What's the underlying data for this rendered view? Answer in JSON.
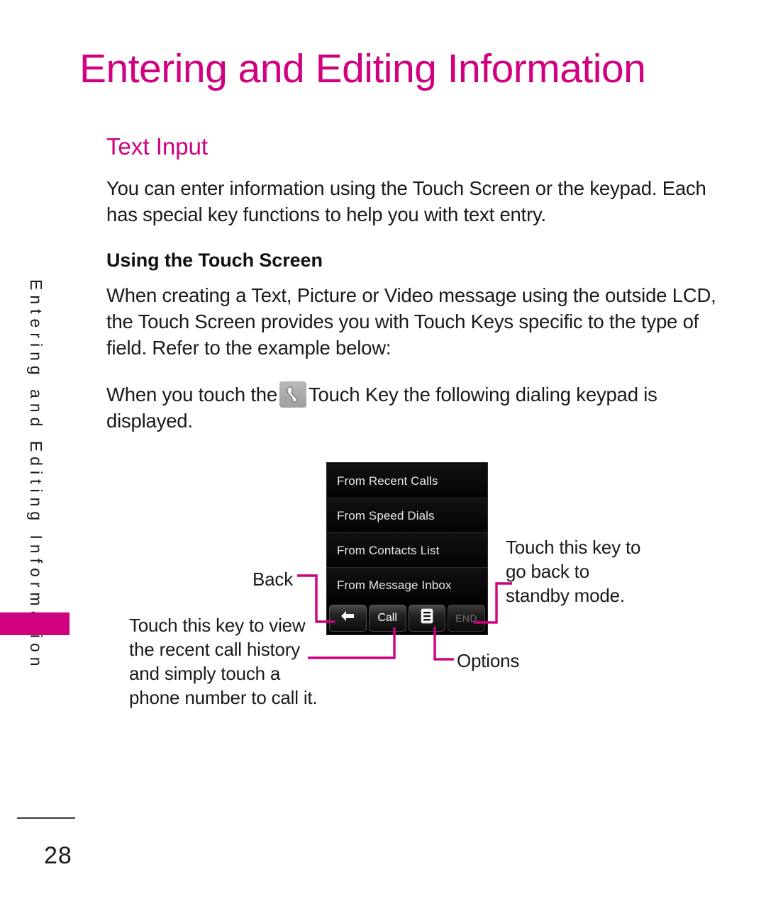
{
  "page": {
    "header_title": "Entering and Editing Information",
    "side_tab_text": "Entering and Editing Information",
    "page_number": "28",
    "accent_color": "#D1007E"
  },
  "section": {
    "title": "Text Input",
    "intro_paragraph": "You can enter information using the Touch Screen or the keypad. Each has special key functions to help you with text entry.",
    "subheading": "Using the Touch Screen",
    "touch_paragraph": "When creating a Text, Picture or Video message using the outside LCD, the Touch Screen provides you with Touch Keys specific to the type of field. Refer to the example below:",
    "when_paragraph_before": "When you touch the",
    "when_paragraph_after": "Touch Key the following dialing keypad is displayed.",
    "inline_icon_name": "phone-handset-icon"
  },
  "lcd": {
    "menu_items": [
      "From Recent Calls",
      "From Speed Dials",
      "From Contacts List",
      "From Message Inbox"
    ],
    "buttons": [
      {
        "label": "",
        "icon": "back-arrow-icon",
        "name": "back-key",
        "dim": false
      },
      {
        "label": "Call",
        "icon": "",
        "name": "call-key",
        "dim": false
      },
      {
        "label": "",
        "icon": "options-list-icon",
        "name": "options-key",
        "dim": false
      },
      {
        "label": "END",
        "icon": "",
        "name": "end-key",
        "dim": true
      }
    ]
  },
  "callouts": {
    "back": "Back",
    "history": "Touch this key to view the recent call history and simply touch a phone number to call it.",
    "standby": "Touch this key to go back to standby mode.",
    "options": "Options"
  }
}
